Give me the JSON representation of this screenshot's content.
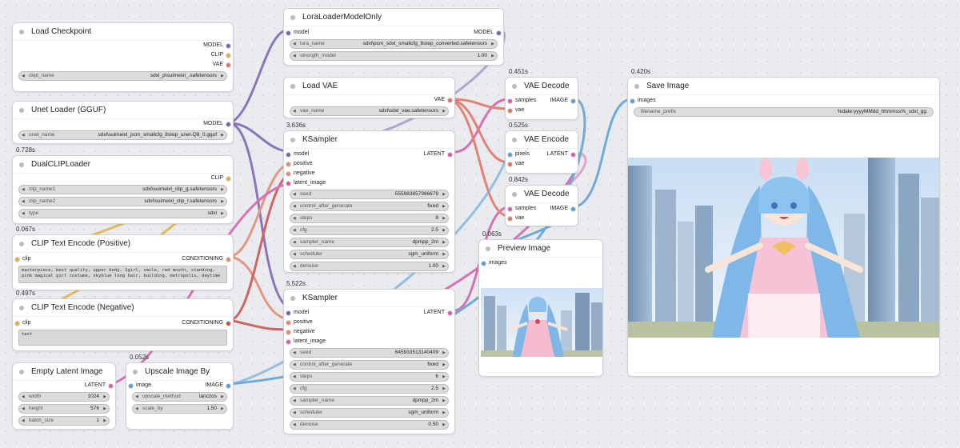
{
  "colors": {
    "model": "#7b5fb0",
    "clip": "#e0b040",
    "vae": "#e07060",
    "latent": "#d35da8",
    "conditioning": "#e08a70",
    "image": "#5a9fd4",
    "seed": "#555"
  },
  "load_checkpoint": {
    "title": "Load Checkpoint",
    "outputs": [
      "MODEL",
      "CLIP",
      "VAE"
    ],
    "ckpt_label": "ckpt_name",
    "ckpt_value": "sdxl_p\\suimeixl_.safetensors"
  },
  "unet_loader": {
    "title": "Unet Loader (GGUF)",
    "output": "MODEL",
    "label": "unet_name",
    "value": "sdxl\\suimeixl_pcm_smallcfg_8step_unet-Q8_0.gguf"
  },
  "dualclip": {
    "time": "0.728s",
    "title": "DualCLIPLoader",
    "output": "CLIP",
    "widgets": [
      {
        "label": "clip_name1",
        "value": "sdxl\\suimeixl_clip_g.safetensors"
      },
      {
        "label": "clip_name2",
        "value": "sdxl\\suimeixl_clip_l.safetensors"
      },
      {
        "label": "type",
        "value": "sdxl"
      }
    ]
  },
  "clip_pos": {
    "time": "0.067s",
    "title": "CLIP Text Encode (Positive)",
    "input": "clip",
    "output": "CONDITIONING",
    "text": "masterpiece, best quality, upper body, 1girl, smile, red mouth, standing, pink magical girl costume, skyblue long hair, building, metropolis, daytime"
  },
  "clip_neg": {
    "time": "0.497s",
    "title": "CLIP Text Encode (Negative)",
    "input": "clip",
    "output": "CONDITIONING",
    "text": "text"
  },
  "empty_latent": {
    "title": "Empty Latent Image",
    "output": "LATENT",
    "widgets": [
      {
        "label": "width",
        "value": "1024"
      },
      {
        "label": "height",
        "value": "576"
      },
      {
        "label": "batch_size",
        "value": "1"
      }
    ]
  },
  "upscale": {
    "time": "0.052s",
    "title": "Upscale Image By",
    "input": "image",
    "output": "IMAGE",
    "widgets": [
      {
        "label": "upscale_method",
        "value": "lanczos"
      },
      {
        "label": "scale_by",
        "value": "1.50"
      }
    ]
  },
  "lora": {
    "title": "LoraLoaderModelOnly",
    "input": "model",
    "output": "MODEL",
    "widgets": [
      {
        "label": "lora_name",
        "value": "sdxl\\pcm_sdxl_smallcfg_8step_converted.safetensors"
      },
      {
        "label": "strength_model",
        "value": "1.00"
      }
    ]
  },
  "load_vae": {
    "title": "Load VAE",
    "output": "VAE",
    "label": "vae_name",
    "value": "sdxl\\sdxl_vae.safetensors"
  },
  "ksampler1": {
    "time": "3.636s",
    "title": "KSampler",
    "inputs": [
      "model",
      "positive",
      "negative",
      "latent_image"
    ],
    "output": "LATENT",
    "widgets": [
      {
        "label": "seed",
        "value": "555983857986679"
      },
      {
        "label": "control_after_generate",
        "value": "fixed"
      },
      {
        "label": "steps",
        "value": "8"
      },
      {
        "label": "cfg",
        "value": "2.5"
      },
      {
        "label": "sampler_name",
        "value": "dpmpp_2m"
      },
      {
        "label": "scheduler",
        "value": "sgm_uniform"
      },
      {
        "label": "denoise",
        "value": "1.00"
      }
    ]
  },
  "ksampler2": {
    "time": "5.522s",
    "title": "KSampler",
    "inputs": [
      "model",
      "positive",
      "negative",
      "latent_image"
    ],
    "output": "LATENT",
    "widgets": [
      {
        "label": "seed",
        "value": "645933513140409"
      },
      {
        "label": "control_after_generate",
        "value": "fixed"
      },
      {
        "label": "steps",
        "value": "6"
      },
      {
        "label": "cfg",
        "value": "2.5"
      },
      {
        "label": "sampler_name",
        "value": "dpmpp_2m"
      },
      {
        "label": "scheduler",
        "value": "sgm_uniform"
      },
      {
        "label": "denoise",
        "value": "0.50"
      }
    ]
  },
  "vae_decode1": {
    "time": "0.451s",
    "title": "VAE Decode",
    "inputs": [
      "samples",
      "vae"
    ],
    "output": "IMAGE"
  },
  "vae_encode": {
    "time": "0.525s",
    "title": "VAE Encode",
    "inputs": [
      "pixels",
      "vae"
    ],
    "output": "LATENT"
  },
  "vae_decode2": {
    "time": "0.842s",
    "title": "VAE Decode",
    "inputs": [
      "samples",
      "vae"
    ],
    "output": "IMAGE"
  },
  "preview": {
    "time": "0.063s",
    "title": "Preview Image",
    "input": "images"
  },
  "save": {
    "time": "0.420s",
    "title": "Save Image",
    "input": "images",
    "label": "filename_prefix",
    "value": "%date:yyyyMMdd_hhmmss%_sdxl_gg"
  }
}
